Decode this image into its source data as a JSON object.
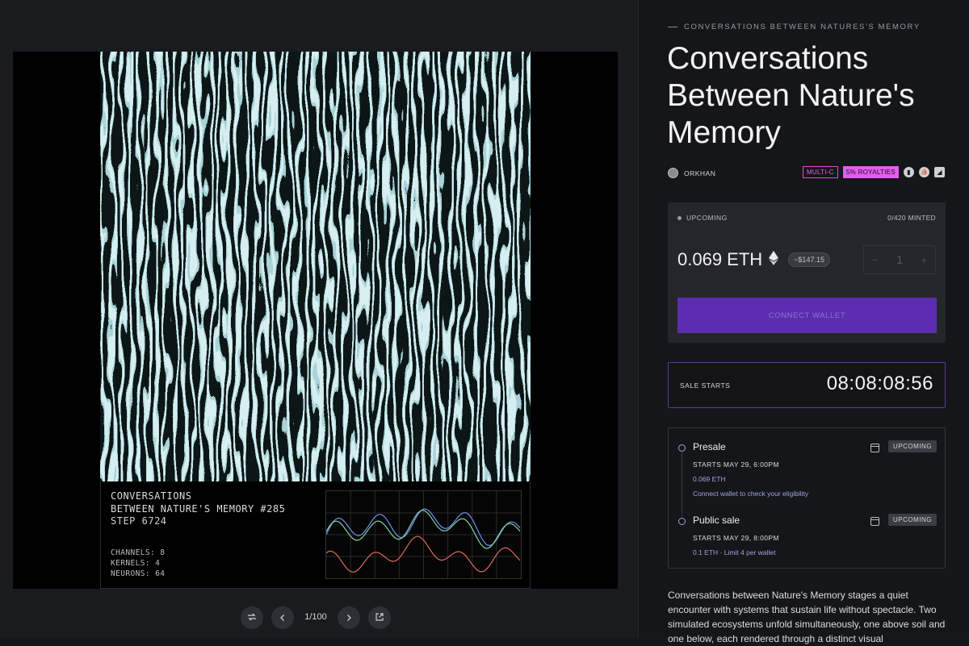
{
  "viewer": {
    "info": {
      "title_line1": "CONVERSATIONS",
      "title_line2": "BETWEEN NATURE'S MEMORY #285",
      "step": "STEP 6724",
      "channels": "CHANNELS: 8",
      "kernels": "KERNELS: 4",
      "neurons": "NEURONS: 64"
    },
    "controls": {
      "counter": "1/100",
      "shuffle_icon": "shuffle-icon",
      "prev_icon": "chevron-left-icon",
      "next_icon": "chevron-right-icon",
      "open_icon": "external-link-icon"
    },
    "plot_colors": {
      "blue": "#6f8ff0",
      "green": "#7fd6a0",
      "red": "#e06a5c"
    }
  },
  "project": {
    "eyebrow": "CONVERSATIONS BETWEEN NATURES'S MEMORY",
    "title": "Conversations Between Nature's Memory",
    "author": "ORKHAN",
    "tags": {
      "multi": "MULTI-C",
      "royalties": "5% ROYALTIES"
    },
    "social_icons": [
      "chart-icon",
      "boat-icon",
      "square-logo-icon"
    ]
  },
  "mint": {
    "status": "UPCOMING",
    "minted": "0/420 MINTED",
    "price": "0.069 ETH",
    "usd": "~$147.15",
    "qty_minus": "−",
    "qty_value": "1",
    "qty_plus": "+",
    "connect_label": "CONNECT WALLET"
  },
  "sale": {
    "label": "SALE STARTS",
    "countdown": "08:08:08:56"
  },
  "phases": [
    {
      "name": "Presale",
      "badge": "UPCOMING",
      "starts": "STARTS MAY 29, 6:00PM",
      "price": "0.069 ETH",
      "note": "Connect wallet to check your eligibility"
    },
    {
      "name": "Public sale",
      "badge": "UPCOMING",
      "starts": "STARTS MAY 29, 8:00PM",
      "price": "0.1 ETH · Limit 4 per wallet"
    }
  ],
  "description": "Conversations between Nature's Memory stages a quiet encounter with systems that sustain life without spectacle. Two simulated ecosystems unfold simultaneously, one above soil and one below, each rendered through a distinct visual"
}
